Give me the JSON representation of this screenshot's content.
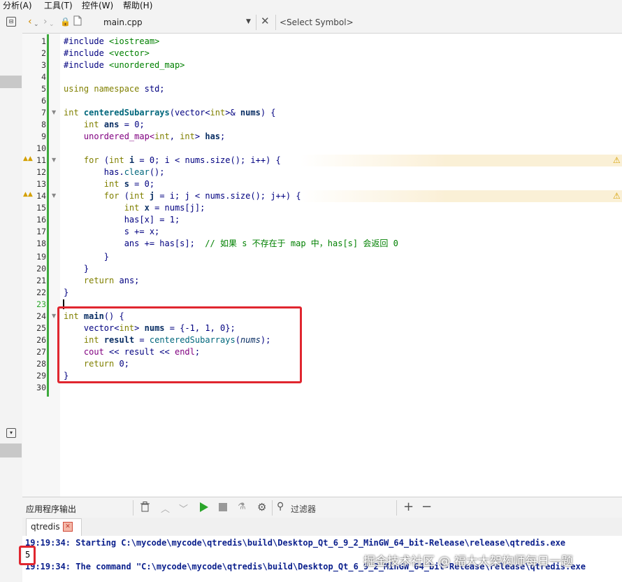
{
  "menu": {
    "items": [
      "分析(A)",
      "工具(T)",
      "控件(W)",
      "帮助(H)"
    ]
  },
  "editor_toolbar": {
    "file_name": "main.cpp",
    "symbol_placeholder": "<Select Symbol>"
  },
  "editor": {
    "line_numbers": [
      "1",
      "2",
      "3",
      "4",
      "5",
      "6",
      "7",
      "8",
      "9",
      "10",
      "11",
      "12",
      "13",
      "14",
      "15",
      "16",
      "17",
      "18",
      "19",
      "20",
      "21",
      "22",
      "23",
      "24",
      "25",
      "26",
      "27",
      "28",
      "29",
      "30"
    ],
    "code": {
      "l1a": "#include",
      "l1b": "<iostream>",
      "l2a": "#include",
      "l2b": "<vector>",
      "l3a": "#include",
      "l3b": "<unordered_map>",
      "l5a": "using",
      "l5b": "namespace",
      "l5c": "std;",
      "l7a": "int",
      "l7b": "centeredSubarrays",
      "l7c": "(vector<",
      "l7d": "int",
      "l7e": ">&",
      "l7f": "nums",
      "l7g": ") {",
      "l8a": "int",
      "l8b": "ans",
      "l8c": " = ",
      "l8d": "0",
      "l8e": ";",
      "l9a": "unordered_map<",
      "l9b": "int",
      "l9c": ", ",
      "l9d": "int",
      "l9e": "> ",
      "l9f": "has",
      "l9g": ";",
      "l11a": "for",
      "l11b": " (",
      "l11c": "int",
      "l11d": "i",
      "l11e": " = ",
      "l11f": "0",
      "l11g": "; i < nums.size(); i++) {",
      "l12a": "has.",
      "l12b": "clear",
      "l12c": "();",
      "l13a": "int",
      "l13b": "s",
      "l13c": " = ",
      "l13d": "0",
      "l13e": ";",
      "l14a": "for",
      "l14b": " (",
      "l14c": "int",
      "l14d": "j",
      "l14e": " = i; j < nums.size(); j++) {",
      "l15a": "int",
      "l15b": "x",
      "l15c": " = nums[j];",
      "l16a": "has[x] = ",
      "l16b": "1",
      "l16c": ";",
      "l17a": "s += x;",
      "l18a": "ans += has[s];  ",
      "l18b": "// 如果 s 不存在于 map 中，has[s] 会返回 0",
      "l19a": "}",
      "l20a": "}",
      "l21a": "return",
      "l21b": " ans;",
      "l22a": "}",
      "l24a": "int",
      "l24b": "main",
      "l24c": "() {",
      "l25a": "vector<",
      "l25b": "int",
      "l25c": "> ",
      "l25d": "nums",
      "l25e": " = {-",
      "l25f": "1",
      "l25g": ", ",
      "l25h": "1",
      "l25i": ", ",
      "l25j": "0",
      "l25k": "};",
      "l26a": "int",
      "l26b": "result",
      "l26c": " = ",
      "l26d": "centeredSubarrays",
      "l26e": "(",
      "l26f": "nums",
      "l26g": ");",
      "l27a": "cout",
      "l27b": " << result << ",
      "l27c": "endl",
      "l27d": ";",
      "l28a": "return",
      "l28b": " ",
      "l28c": "0",
      "l28d": ";",
      "l29a": "}"
    }
  },
  "output_pane": {
    "title": "应用程序输出",
    "filter_placeholder": "过滤器",
    "tab_label": "qtredis",
    "lines": {
      "start": "19:19:34: Starting C:\\mycode\\mycode\\qtredis\\build\\Desktop_Qt_6_9_2_MinGW_64_bit-Release\\release\\qtredis.exe",
      "result": "5",
      "command": "19:19:34: The command \"C:\\mycode\\mycode\\qtredis\\build\\Desktop_Qt_6_9_2_MinGW_64_bit-Release\\release\\qtredis.exe"
    }
  },
  "watermark": "掘金技术社区 @ 福大大架构师每日一题",
  "colors": {
    "highlight_box": "#e0262f",
    "change_bar": "#3daa3d",
    "output_text": "#0a1f8c",
    "run_green": "#2aa52a"
  }
}
